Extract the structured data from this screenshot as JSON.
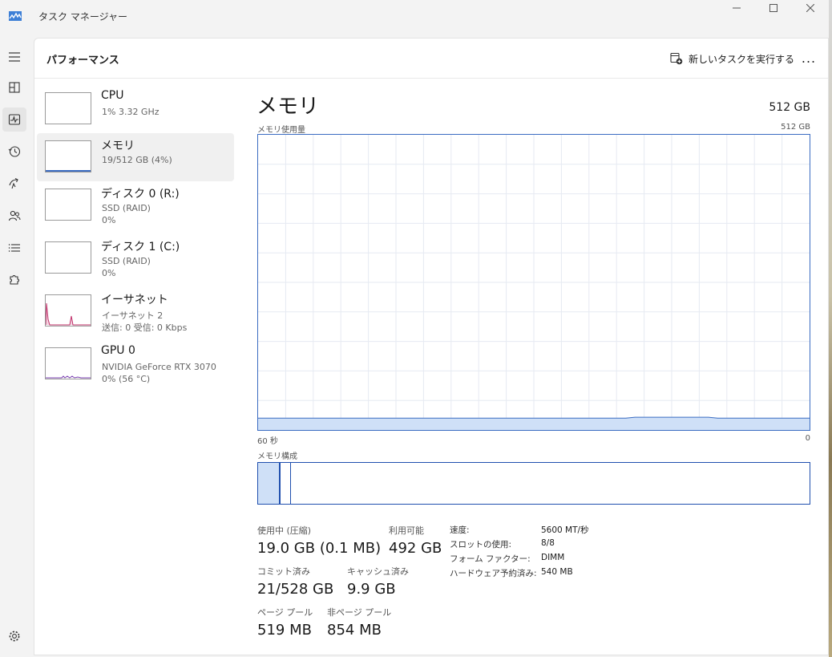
{
  "window": {
    "title": "タスク マネージャー"
  },
  "header": {
    "page_title": "パフォーマンス",
    "run_task_label": "新しいタスクを実行する",
    "more_label": "..."
  },
  "resources": [
    {
      "name": "CPU",
      "line1": "1%  3.32 GHz",
      "line2": "",
      "graph": "cpu"
    },
    {
      "name": "メモリ",
      "line1": "19/512 GB (4%)",
      "line2": "",
      "graph": "memory"
    },
    {
      "name": "ディスク 0 (R:)",
      "line1": "SSD (RAID)",
      "line2": "0%",
      "graph": "disk"
    },
    {
      "name": "ディスク 1 (C:)",
      "line1": "SSD (RAID)",
      "line2": "0%",
      "graph": "disk"
    },
    {
      "name": "イーサネット",
      "line1": "イーサネット 2",
      "line2": "送信: 0 受信: 0 Kbps",
      "graph": "ethernet"
    },
    {
      "name": "GPU 0",
      "line1": "NVIDIA GeForce RTX 3070",
      "line2": "0%  (56 °C)",
      "graph": "gpu"
    }
  ],
  "selected_resource_index": 1,
  "detail": {
    "title": "メモリ",
    "total": "512 GB",
    "usage_label": "メモリ使用量",
    "usage_max": "512 GB",
    "time_left": "60 秒",
    "time_right": "0",
    "composition_label": "メモリ構成"
  },
  "stats": {
    "in_use_label": "使用中 (圧縮)",
    "in_use_value": "19.0 GB (0.1 MB)",
    "available_label": "利用可能",
    "available_value": "492 GB",
    "committed_label": "コミット済み",
    "committed_value": "21/528 GB",
    "cached_label": "キャッシュ済み",
    "cached_value": "9.9 GB",
    "paged_pool_label": "ページ プール",
    "paged_pool_value": "519 MB",
    "nonpaged_pool_label": "非ページ プール",
    "nonpaged_pool_value": "854 MB"
  },
  "specs": [
    {
      "label": "速度:",
      "value": "5600 MT/秒"
    },
    {
      "label": "スロットの使用:",
      "value": "8/8"
    },
    {
      "label": "フォーム ファクター:",
      "value": "DIMM"
    },
    {
      "label": "ハードウェア予約済み:",
      "value": "540 MB"
    }
  ],
  "colors": {
    "accent_blue": "#3b6cc2",
    "memory_fill": "#cfe0f7",
    "ethernet_line": "#c0306a",
    "gpu_line": "#7a3fb0"
  },
  "memory_usage_fraction": 0.04
}
